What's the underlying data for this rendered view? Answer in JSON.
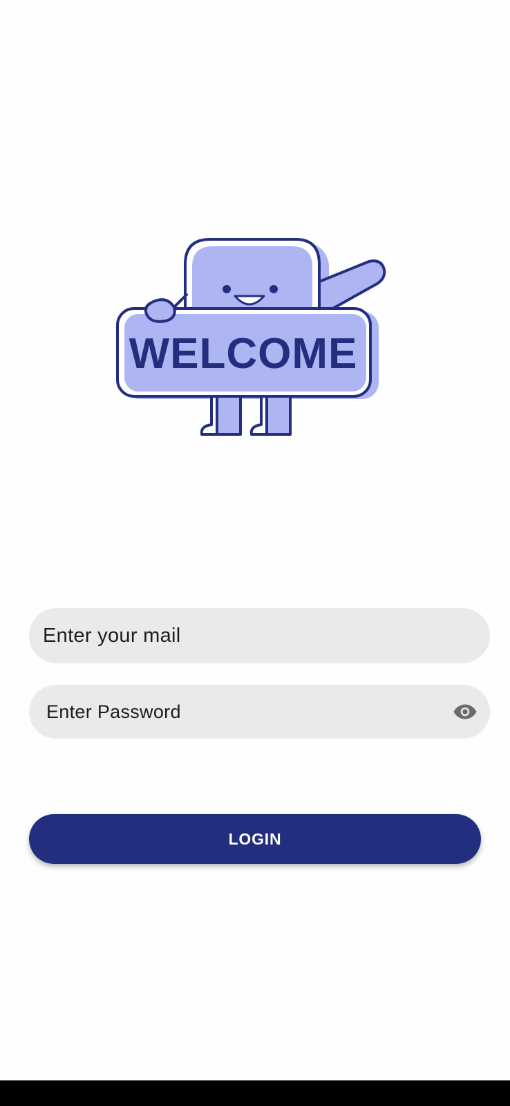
{
  "illustration": {
    "sign_text": "WELCOME",
    "primary_color": "#aeb5f3",
    "outline_color": "#232f7e"
  },
  "login_form": {
    "email_placeholder": "Enter your mail",
    "password_placeholder": "Enter Password",
    "visibility_icon": "eye-icon",
    "login_label": "LOGIN"
  },
  "colors": {
    "button": "#232f7e",
    "field_background": "#eaeaea",
    "nav_bar": "#000000"
  }
}
